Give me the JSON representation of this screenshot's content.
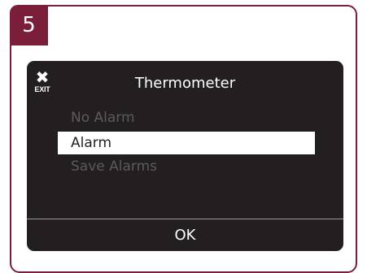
{
  "step": {
    "number": "5"
  },
  "colors": {
    "accent": "#7a1e3a",
    "screen_background": "#231f20",
    "inactive_text": "#5c5a5b",
    "selected_background": "#ffffff"
  },
  "screen": {
    "title": "Thermometer",
    "exit": {
      "icon": "close-icon",
      "glyph": "✖",
      "label": "EXIT"
    },
    "menu": {
      "items": [
        {
          "label": "No Alarm",
          "selected": false
        },
        {
          "label": "Alarm",
          "selected": true
        },
        {
          "label": "Save Alarms",
          "selected": false
        }
      ]
    },
    "ok_label": "OK"
  }
}
